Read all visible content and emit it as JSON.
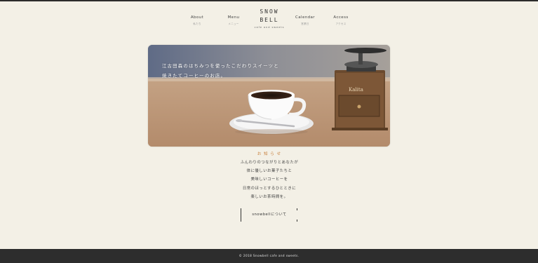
{
  "nav": {
    "left": [
      {
        "label": "About",
        "sub": "私たち"
      },
      {
        "label": "Menu",
        "sub": "メニュー"
      }
    ],
    "right": [
      {
        "label": "Calendar",
        "sub": "営業日"
      },
      {
        "label": "Access",
        "sub": "アクセス"
      }
    ]
  },
  "logo": {
    "line1": "SNOW",
    "line2": "BELL",
    "tagline": "cafe and sweets"
  },
  "hero": {
    "line1": "江古田森のはちみつを使ったこだわりスイーツと",
    "line2": "焼きたてコーヒーのお店。"
  },
  "intro": {
    "title": "お 知 ら せ",
    "lines": [
      "ふんわりのつながりとあなたが",
      "体に優しいお菓子たちと",
      "美味しいコーヒーを",
      "日常のほっとするひとときに",
      "楽しいお茶時間を。"
    ]
  },
  "about_button": {
    "label": "snowbellについて"
  },
  "footer": {
    "text": "© 2018 Snowbell cafe and sweets."
  },
  "colors": {
    "background": "#f3f0e6",
    "footer": "#2d2d2d",
    "accent": "#c77e3a"
  }
}
